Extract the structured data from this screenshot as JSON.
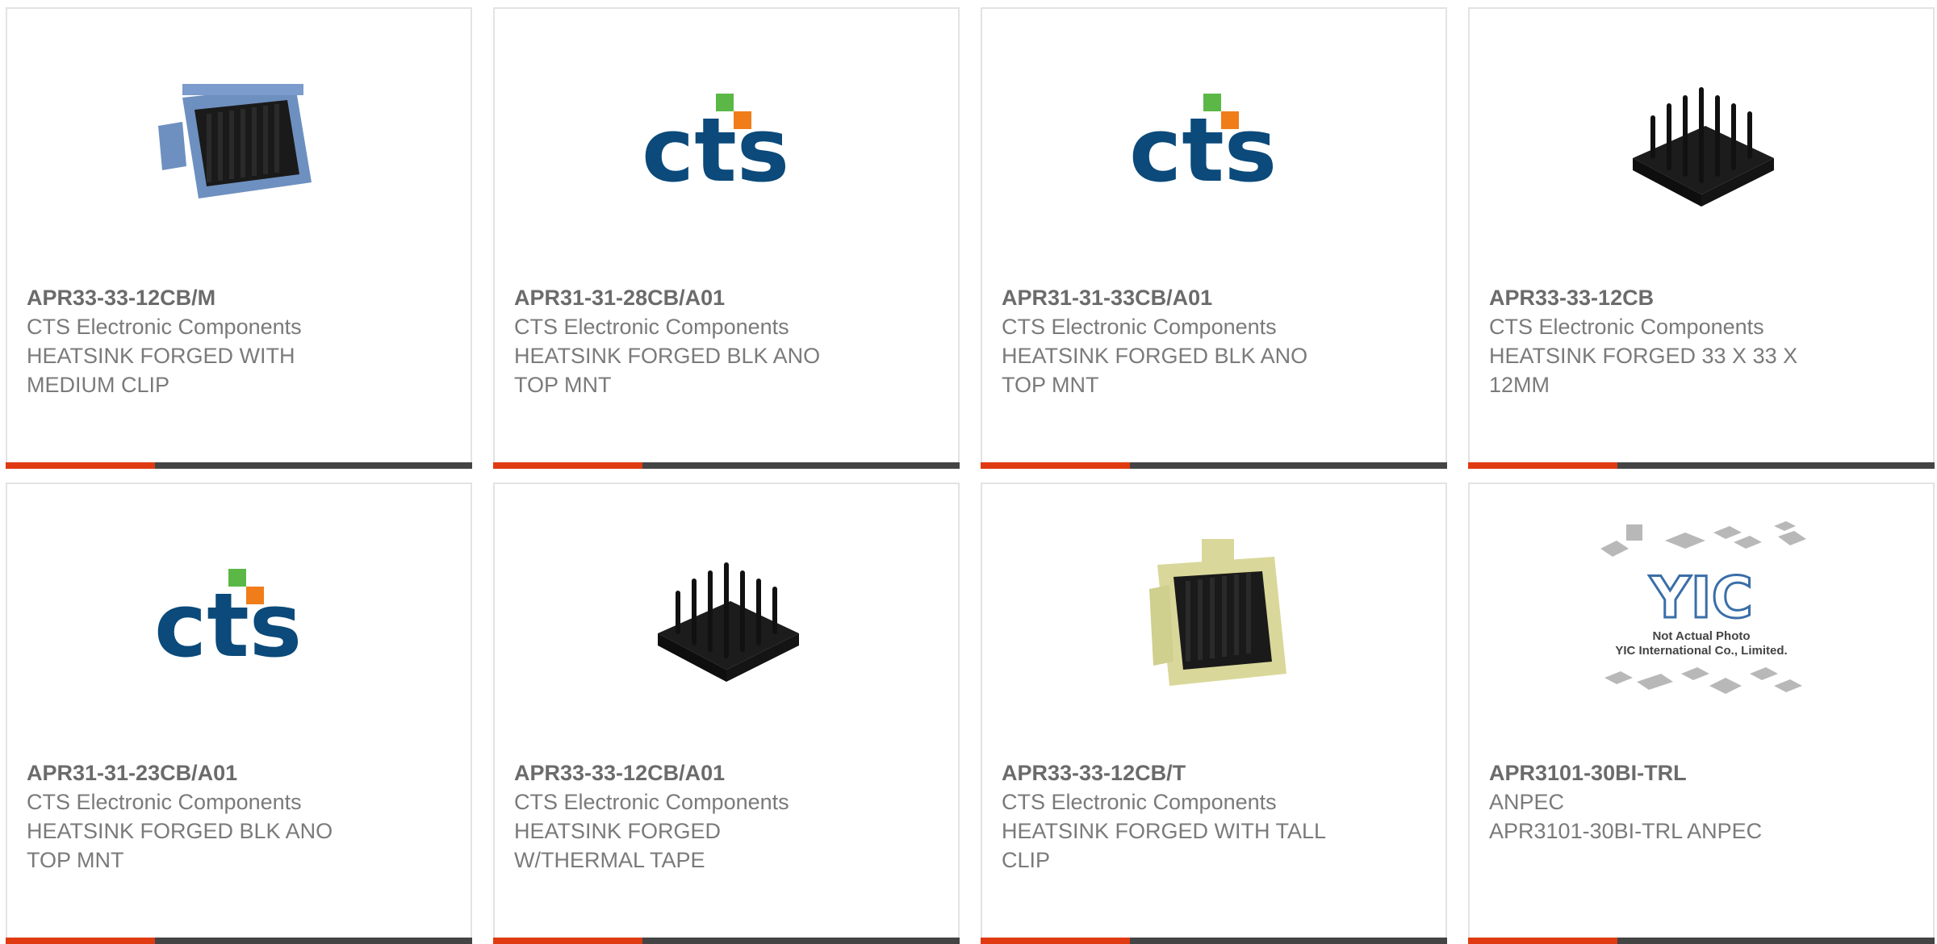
{
  "products": [
    {
      "part_number": "APR33-33-12CB/M",
      "manufacturer": "CTS Electronic Components",
      "description": "HEATSINK FORGED WITH MEDIUM CLIP",
      "image": "heatsink-blue-clip"
    },
    {
      "part_number": "APR31-31-28CB/A01",
      "manufacturer": "CTS Electronic Components",
      "description": "HEATSINK FORGED BLK ANO TOP MNT",
      "image": "cts-logo"
    },
    {
      "part_number": "APR31-31-33CB/A01",
      "manufacturer": "CTS Electronic Components",
      "description": "HEATSINK FORGED BLK ANO TOP MNT",
      "image": "cts-logo"
    },
    {
      "part_number": "APR33-33-12CB",
      "manufacturer": "CTS Electronic Components",
      "description": "HEATSINK FORGED 33 X 33 X 12MM",
      "image": "heatsink-black"
    },
    {
      "part_number": "APR31-31-23CB/A01",
      "manufacturer": "CTS Electronic Components",
      "description": "HEATSINK FORGED BLK ANO TOP MNT",
      "image": "cts-logo"
    },
    {
      "part_number": "APR33-33-12CB/A01",
      "manufacturer": "CTS Electronic Components",
      "description": "HEATSINK FORGED W/THERMAL TAPE",
      "image": "heatsink-black"
    },
    {
      "part_number": "APR33-33-12CB/T",
      "manufacturer": "CTS Electronic Components",
      "description": "HEATSINK FORGED WITH TALL CLIP",
      "image": "heatsink-yellow-clip"
    },
    {
      "part_number": "APR3101-30BI-TRL",
      "manufacturer": "ANPEC",
      "description": "APR3101-30BI-TRL ANPEC",
      "image": "placeholder-not-actual-photo",
      "placeholder": {
        "brand": "YIC",
        "line1": "Not Actual Photo",
        "line2": "YIC International Co., Limited."
      }
    }
  ],
  "colors": {
    "accent": "#e03a12",
    "bar": "#444444",
    "cts_blue": "#0b4a7a",
    "cts_green": "#5bb846",
    "cts_orange": "#f07d1a"
  }
}
